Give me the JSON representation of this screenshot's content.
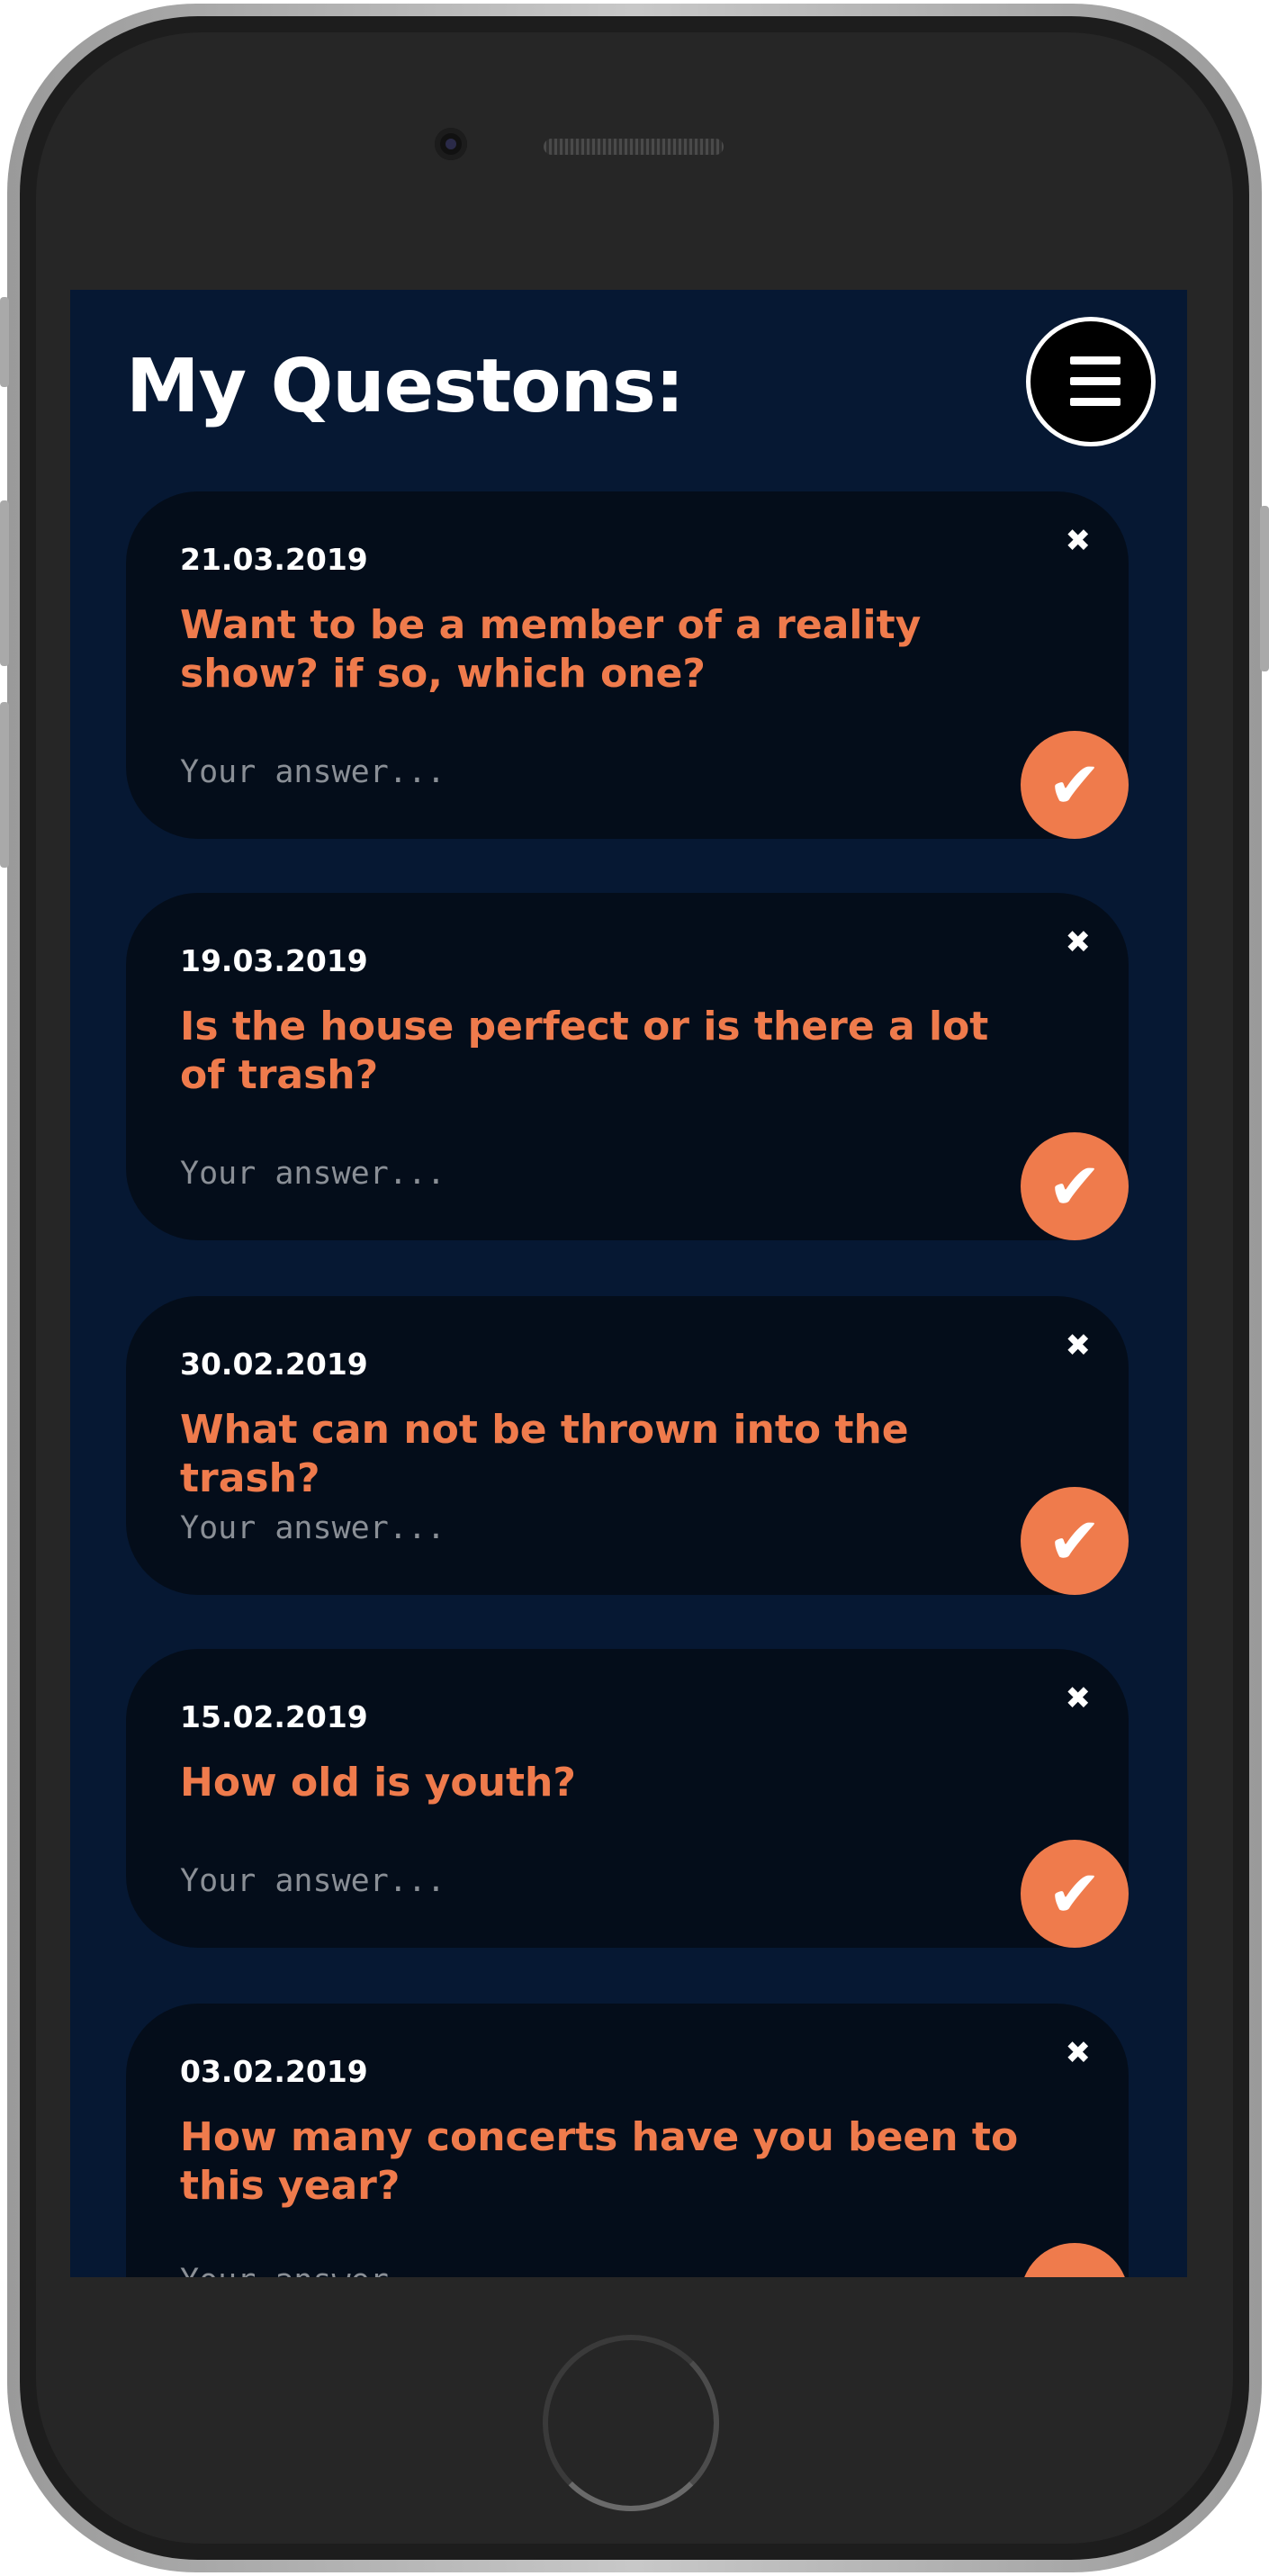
{
  "header": {
    "title": "My Questons:"
  },
  "questions": [
    {
      "date": "21.03.2019",
      "text": "Want to be a member of a reality show? if so, which one?",
      "placeholder": "Your answer..."
    },
    {
      "date": "19.03.2019",
      "text": "Is the house perfect or is there a lot of trash?",
      "placeholder": "Your answer..."
    },
    {
      "date": "30.02.2019",
      "text": "What can not be thrown into the trash?",
      "placeholder": "Your answer..."
    },
    {
      "date": "15.02.2019",
      "text": "How old is youth?",
      "placeholder": "Your answer..."
    },
    {
      "date": "03.02.2019",
      "text": "How many concerts have you been to this year?",
      "placeholder": "Your answer..."
    }
  ],
  "icons": {
    "close": "✖",
    "submit": "✔"
  },
  "colors": {
    "background": "#061833",
    "card": "#040d1a",
    "accent": "#ef7b4c",
    "text": "#ffffff"
  }
}
